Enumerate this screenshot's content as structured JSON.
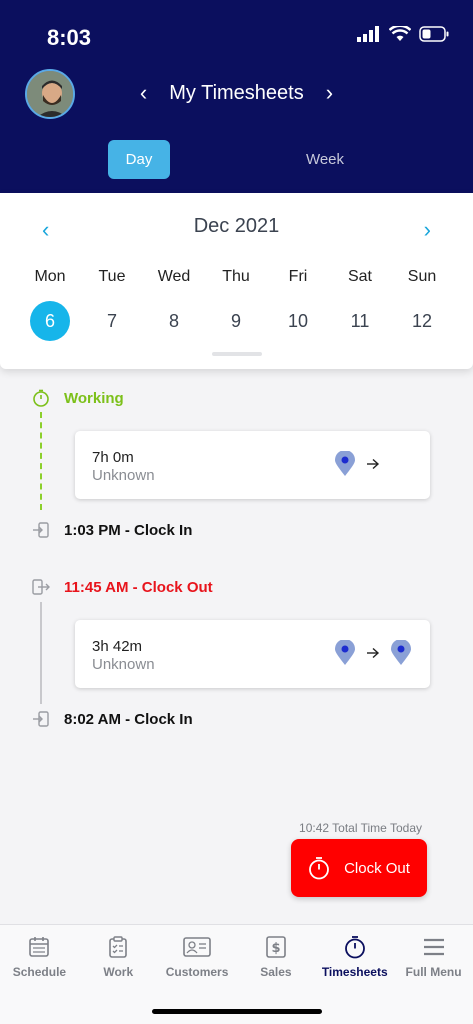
{
  "status_bar": {
    "time": "8:03"
  },
  "header": {
    "title": "My Timesheets",
    "tabs": {
      "day": "Day",
      "week": "Week"
    }
  },
  "calendar": {
    "month_label": "Dec 2021",
    "days": [
      {
        "name": "Mon",
        "num": "6",
        "selected": true
      },
      {
        "name": "Tue",
        "num": "7"
      },
      {
        "name": "Wed",
        "num": "8"
      },
      {
        "name": "Thu",
        "num": "9"
      },
      {
        "name": "Fri",
        "num": "10"
      },
      {
        "name": "Sat",
        "num": "11"
      },
      {
        "name": "Sun",
        "num": "12"
      }
    ]
  },
  "timeline": {
    "working_label": "Working",
    "entry1": {
      "duration": "7h 0m",
      "location": "Unknown"
    },
    "clock_in_1": "1:03 PM - Clock In",
    "clock_out": "11:45 AM - Clock Out",
    "entry2": {
      "duration": "3h 42m",
      "location": "Unknown"
    },
    "clock_in_2": "8:02 AM - Clock In"
  },
  "total_today": "10:42 Total Time Today",
  "clock_out_button": "Clock Out",
  "tabbar": [
    {
      "label": "Schedule",
      "icon": "calendar-icon"
    },
    {
      "label": "Work",
      "icon": "clipboard-icon"
    },
    {
      "label": "Customers",
      "icon": "contact-card-icon"
    },
    {
      "label": "Sales",
      "icon": "dollar-icon"
    },
    {
      "label": "Timesheets",
      "icon": "stopwatch-icon",
      "active": true
    },
    {
      "label": "Full Menu",
      "icon": "menu-icon"
    }
  ],
  "colors": {
    "header_bg": "#0b0f5e",
    "accent": "#16b5ea",
    "working": "#7cc01a",
    "clock_out": "#ff0000"
  }
}
